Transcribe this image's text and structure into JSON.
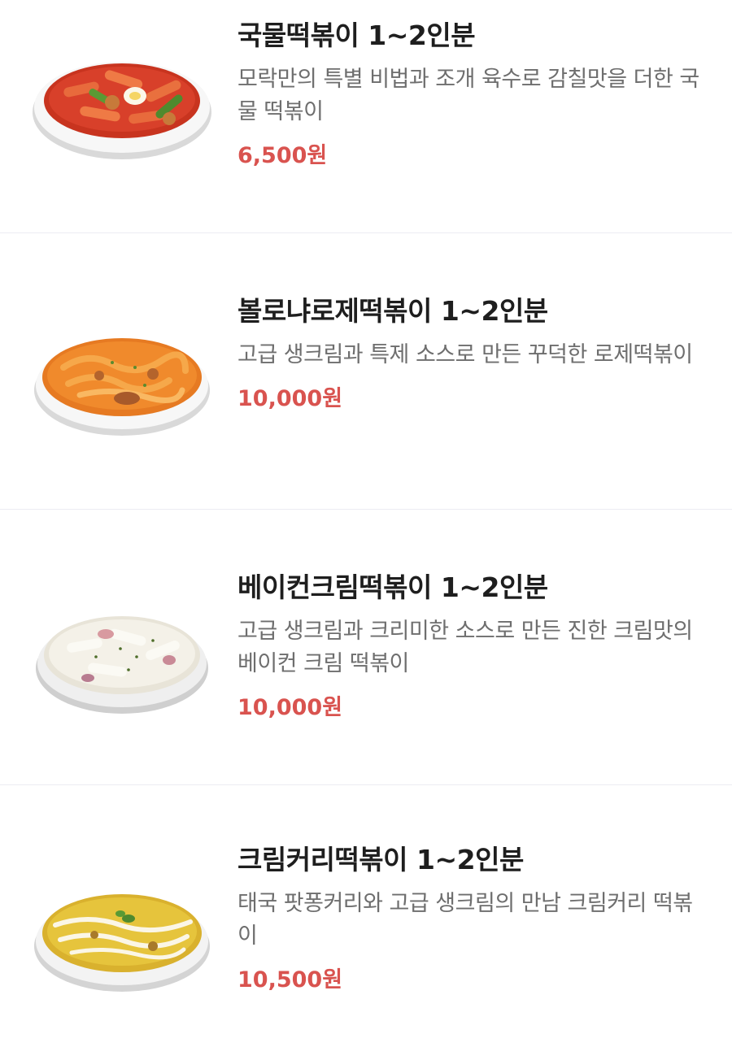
{
  "menu": {
    "items": [
      {
        "name": "국물떡볶이 1~2인분",
        "description": "모락만의 특별 비법과 조개 육수로 감칠맛을 더한 국물 떡볶이",
        "price": "6,500원",
        "sauce_color": "#d8402a",
        "image_icon": "spicy-soup-tteokbokki-image"
      },
      {
        "name": "볼로냐로제떡볶이 1~2인분",
        "description": "고급 생크림과 특제 소스로 만든 꾸덕한 로제떡볶이",
        "price": "10,000원",
        "sauce_color": "#f08a2c",
        "image_icon": "rose-tteokbokki-image"
      },
      {
        "name": "베이컨크림떡볶이 1~2인분",
        "description": "고급 생크림과 크리미한 소스로 만든 진한 크림맛의 베이컨 크림 떡볶이",
        "price": "10,000원",
        "sauce_color": "#f2efe6",
        "image_icon": "bacon-cream-tteokbokki-image"
      },
      {
        "name": "크림커리떡볶이 1~2인분",
        "description": "태국 팟퐁커리와 고급 생크림의 만남 크림커리 떡볶이",
        "price": "10,500원",
        "sauce_color": "#e6c43c",
        "image_icon": "cream-curry-tteokbokki-image"
      }
    ]
  },
  "colors": {
    "price": "#d9534f",
    "divider": "#ececf2"
  }
}
